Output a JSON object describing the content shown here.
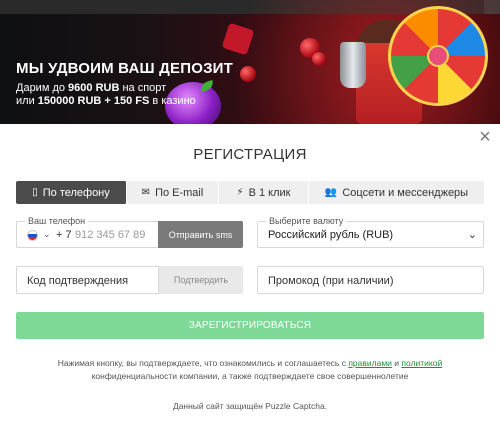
{
  "banner": {
    "title": "МЫ УДВОИМ ВАШ ДЕПОЗИТ",
    "line1_prefix": "Дарим до ",
    "line1_amount": "9600 RUB",
    "line1_suffix": " на спорт",
    "line2_prefix": "или ",
    "line2_amount": "150000 RUB + 150 FS",
    "line2_suffix": " в казино"
  },
  "modal": {
    "close_glyph": "×",
    "title": "РЕГИСТРАЦИЯ",
    "tabs": [
      {
        "label": "По телефону",
        "icon": "phone-icon",
        "glyph": "▯",
        "active": true
      },
      {
        "label": "По E-mail",
        "icon": "envelope-icon",
        "glyph": "✉",
        "active": false
      },
      {
        "label": "В 1 клик",
        "icon": "lightning-icon",
        "glyph": "⚡",
        "active": false
      },
      {
        "label": "Соцсети и мессенджеры",
        "icon": "users-icon",
        "glyph": "👥",
        "active": false
      }
    ],
    "phone": {
      "label": "Ваш телефон",
      "country_icon": "russia-flag-icon",
      "prefix": "+ 7",
      "placeholder": "912 345 67 89",
      "value": "",
      "sms_button": "Отправить sms"
    },
    "currency": {
      "label": "Выберите валюту",
      "selected": "Российский рубль (RUB)"
    },
    "code": {
      "placeholder": "Код подтверждения",
      "value": "",
      "confirm_button": "Подтвердить"
    },
    "promo": {
      "placeholder": "Промокод (при наличии)",
      "value": ""
    },
    "register_button": "ЗАРЕГИСТРИРОВАТЬСЯ",
    "terms": {
      "part1": "Нажимая кнопку, вы подтверждаете, что ознакомились и соглашаетесь с ",
      "link_rules": "правилами",
      "part2": " и ",
      "link_policy": "политикой",
      "part3": "конфиденциальности компании, а также подтверждаете свое совершеннолетие"
    },
    "captcha_text": "Данный сайт защищён Puzzle Captcha."
  },
  "colors": {
    "active_tab": "#4b4b4b",
    "sms_button": "#7a7a7a",
    "register_button": "#7ed997",
    "link": "#1f8f3a"
  }
}
